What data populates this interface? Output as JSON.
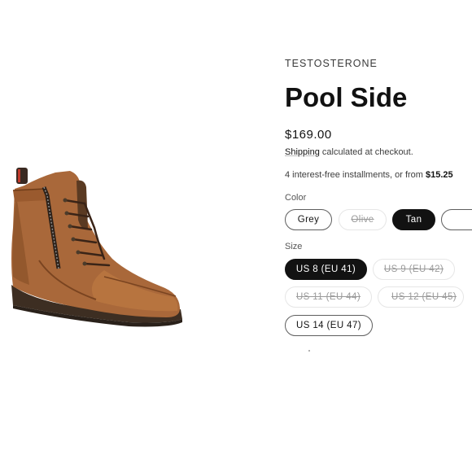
{
  "product": {
    "vendor": "TESTOSTERONE",
    "title": "Pool Side",
    "price": "$169.00",
    "shipping_link": "Shipping",
    "shipping_text": " calculated at checkout.",
    "installments_text": "4 interest-free installments, or from ",
    "installments_amount": "$15.25"
  },
  "color": {
    "label": "Color",
    "options": [
      {
        "label": "Grey",
        "state": "available"
      },
      {
        "label": "Olive",
        "state": "unavailable"
      },
      {
        "label": "Tan",
        "state": "selected"
      },
      {
        "label": "",
        "state": "available"
      }
    ]
  },
  "size": {
    "label": "Size",
    "options": [
      {
        "label": "US 8 (EU 41)",
        "state": "selected"
      },
      {
        "label": "US 9 (EU 42)",
        "state": "unavailable"
      },
      {
        "label": "US 11 (EU 44)",
        "state": "unavailable"
      },
      {
        "label": "US 12 (EU 45)",
        "state": "unavailable"
      },
      {
        "label": "US 14 (EU 47)",
        "state": "available"
      }
    ]
  },
  "image": {
    "icon": "tan-leather-boot-image"
  }
}
